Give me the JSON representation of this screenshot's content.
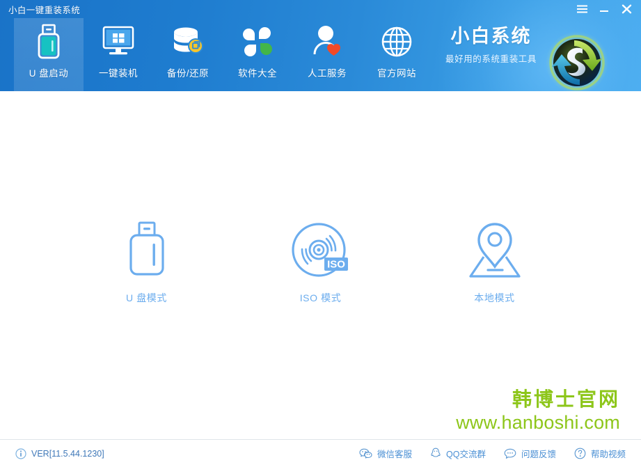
{
  "window": {
    "title": "小白一键重装系统",
    "controls": [
      {
        "name": "menu",
        "icon": "hamburger-icon",
        "label": "菜单"
      },
      {
        "name": "minimize",
        "icon": "minimize-icon",
        "label": "最小化"
      },
      {
        "name": "close",
        "icon": "close-icon",
        "label": "关闭"
      }
    ]
  },
  "nav": {
    "items": [
      {
        "label": "U 盘启动",
        "icon": "usb-drive-icon",
        "active": true
      },
      {
        "label": "一键装机",
        "icon": "monitor-windows-icon",
        "active": false
      },
      {
        "label": "备份/还原",
        "icon": "database-backup-icon",
        "active": false
      },
      {
        "label": "软件大全",
        "icon": "clover-icon",
        "active": false
      },
      {
        "label": "人工服务",
        "icon": "person-heart-icon",
        "active": false
      },
      {
        "label": "官方网站",
        "icon": "globe-icon",
        "active": false
      }
    ]
  },
  "brand": {
    "name": "小白系统",
    "slogan": "最好用的系统重装工具",
    "logo_icon": "circular-refresh-logo"
  },
  "main": {
    "modes": [
      {
        "label": "U 盘模式",
        "icon": "usb-stick-outline-icon"
      },
      {
        "label": "ISO 模式",
        "icon": "iso-disc-outline-icon",
        "badge": "ISO"
      },
      {
        "label": "本地模式",
        "icon": "map-pin-outline-icon"
      }
    ]
  },
  "watermark": {
    "cn": "韩博士官网",
    "url": "www.hanboshi.com",
    "color": "#8dc61a"
  },
  "footer": {
    "version": "VER[11.5.44.1230]",
    "version_icon": "info-icon",
    "links": [
      {
        "label": "微信客服",
        "icon": "wechat-icon"
      },
      {
        "label": "QQ交流群",
        "icon": "qq-penguin-icon"
      },
      {
        "label": "问题反馈",
        "icon": "chat-bubble-icon"
      },
      {
        "label": "帮助视频",
        "icon": "question-circle-icon"
      }
    ]
  },
  "colors": {
    "header_blue": "#1e7ccf",
    "accent_light_blue": "#6cadee",
    "watermark_green": "#8dc61a",
    "footer_link": "#4a8fd4"
  }
}
